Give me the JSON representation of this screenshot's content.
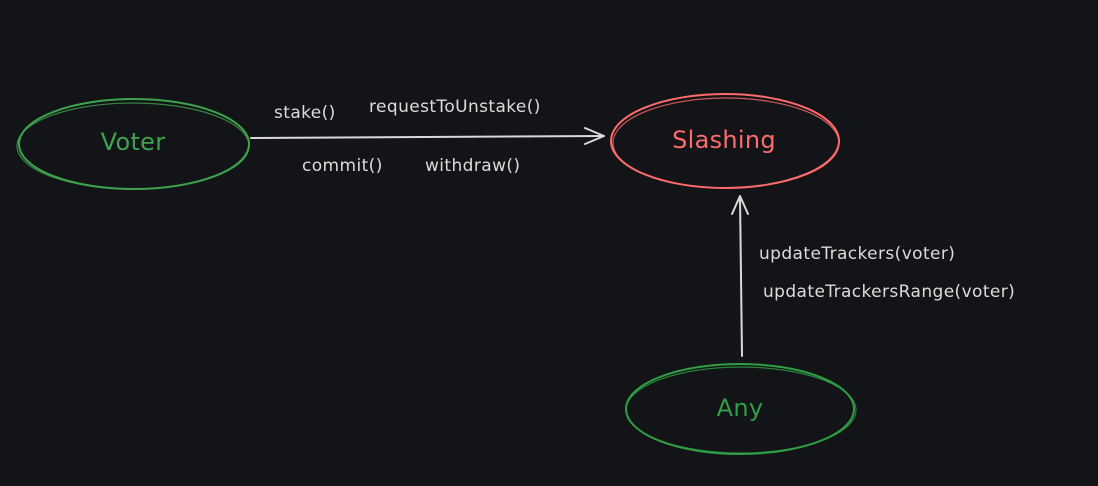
{
  "colors": {
    "background": "#121417",
    "voter": "#3fa34d",
    "slashing": "#ff6b6b",
    "any": "#2f9e44",
    "arrow": "#d9d9d9",
    "label": "#dcdcdc"
  },
  "nodes": {
    "voter": {
      "label": "Voter"
    },
    "slashing": {
      "label": "Slashing"
    },
    "any": {
      "label": "Any"
    }
  },
  "edges": {
    "voter_to_slashing": {
      "labels": [
        "stake()",
        "requestToUnstake()",
        "commit()",
        "withdraw()"
      ]
    },
    "any_to_slashing": {
      "labels": [
        "updateTrackers(voter)",
        "updateTrackersRange(voter)"
      ]
    }
  }
}
